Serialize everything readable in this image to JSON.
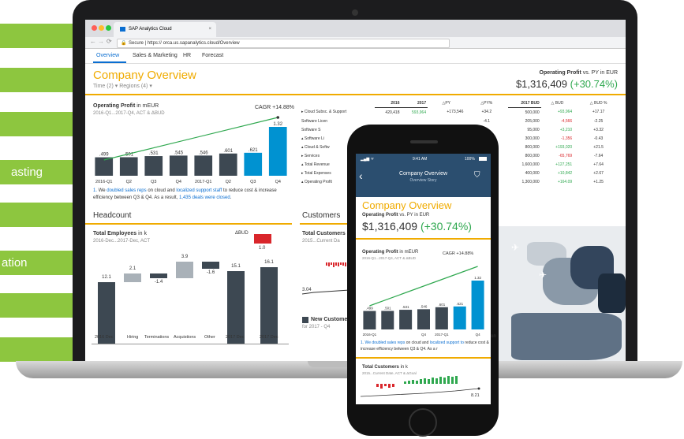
{
  "left_menu": {
    "items": [
      "",
      "",
      "",
      "asting",
      "",
      "ation",
      "",
      ""
    ]
  },
  "browser": {
    "tab_title": "SAP Analytics Cloud",
    "address": "Secure | https:// orca.us.sapanalytics.cloud/Overview"
  },
  "nav": {
    "tabs": [
      "Overview",
      "Sales & Marketing",
      "HR",
      "Forecast"
    ]
  },
  "page": {
    "title": "Company Overview",
    "filters": "Time (2) ▾  Regions (4) ▾",
    "kpi_label": "Operating Profit",
    "kpi_label_rest": "vs. PY in EUR",
    "kpi_value": "$1,316,409",
    "kpi_change": "(+30.74%)"
  },
  "op_chart": {
    "title": "Operating Profit",
    "title_rest": "in mEUR",
    "subtitle": "2016-Q1...2017-Q4, ACT & ΔBUD",
    "cagr": "CAGR +14.88%",
    "footnote_1": "1.",
    "footnote_a": "We",
    "footnote_link1": "doubled sales reps",
    "footnote_b": "on cloud and",
    "footnote_link2": "localized support staff",
    "footnote_c": "to reduce cost & increase",
    "footnote_d": "efficiency between Q3 & Q4. As a result,",
    "footnote_link3": "1,435 deals were closed",
    "footnote_e": "."
  },
  "chart_data": {
    "type": "bar",
    "categories": [
      "2016-Q1",
      "Q2",
      "Q3",
      "Q4",
      "2017-Q1",
      "Q2",
      "Q3",
      "Q4"
    ],
    "values": [
      0.499,
      0.501,
      0.531,
      0.545,
      0.546,
      0.601,
      0.621,
      1.32
    ],
    "value_labels": [
      ".499",
      ".501",
      ".531",
      ".545",
      ".546",
      ".601",
      ".621",
      "1.32"
    ],
    "colors": [
      "#3d4852",
      "#3d4852",
      "#3d4852",
      "#3d4852",
      "#3d4852",
      "#3d4852",
      "#0092d1",
      "#0092d1"
    ]
  },
  "headcount": {
    "section": "Headcount",
    "title": "Total Employees",
    "title_rest": "in k",
    "subtitle": "2016-Dec...2017-Dec, ACT",
    "dbud": "ΔBUD",
    "dbud_value": "1.0",
    "categories": [
      "2016 Dec",
      "Hiring",
      "Terminations",
      "Acquistions",
      "Other",
      "2017 Dec",
      "2017 Dec"
    ],
    "values": [
      "12.1",
      "2.1",
      "-1.4",
      "3.9",
      "-1.6",
      "15.1",
      "16.1"
    ]
  },
  "customers": {
    "section": "Customers",
    "title": "Total Customers",
    "subtitle": "2015...Current Da",
    "value": "3.04",
    "new_title": "New Custome",
    "new_sub": "for 2017 - Q4"
  },
  "pl_table": {
    "headers": [
      "2016",
      "2017",
      "△PY",
      "△PY%",
      "2017 BUD",
      "△ BUD",
      "△ BUD %"
    ],
    "rows": [
      {
        "label": "▸ Cloud Subsc. & Support",
        "v2016": "420,418",
        "v2017": "593,964",
        "dpy": "+173,546",
        "dpyp": "+34.2",
        "bud": "500,000",
        "dbud": "+93,964",
        "dbudp": "+17.17"
      },
      {
        "label": "Software Licen",
        "v2016": "",
        "v2017": "",
        "dpy": "",
        "dpyp": "-4.1",
        "bud": "205,000",
        "dbud": "-4,566",
        "dbudp": "-2.25"
      },
      {
        "label": "Software S",
        "v2016": "",
        "v2017": "",
        "dpy": "",
        "dpyp": "",
        "bud": "95,000",
        "dbud": "+3,210",
        "dbudp": "+3.32"
      },
      {
        "label": "▴ Software Li",
        "v2016": "",
        "v2017": "",
        "dpy": "",
        "dpyp": "",
        "bud": "300,000",
        "dbud": "-1,356",
        "dbudp": "-0.43"
      },
      {
        "label": "▴ Cloud & Softw",
        "v2016": "",
        "v2017": "",
        "dpy": "",
        "dpyp": "9.8",
        "bud": "800,000",
        "dbud": "+193,020",
        "dbudp": "+21.5"
      },
      {
        "label": "▸ Services",
        "v2016": "",
        "v2017": "",
        "dpy": "",
        "dpyp": "",
        "bud": "800,000",
        "dbud": "-65,769",
        "dbudp": "-7.64"
      },
      {
        "label": "▴ Total Revenue",
        "v2016": "",
        "v2017": "",
        "dpy": "",
        "dpyp": "",
        "bud": "1,600,000",
        "dbud": "+127,251",
        "dbudp": "+7.64"
      },
      {
        "label": "▸ Total Expenses",
        "v2016": "",
        "v2017": "",
        "dpy": "",
        "dpyp": "",
        "bud": "400,000",
        "dbud": "+10,842",
        "dbudp": "+2.67"
      },
      {
        "label": "▴ Operating Profit",
        "v2016": "",
        "v2017": "",
        "dpy": "",
        "dpyp": "",
        "bud": "1,300,000",
        "dbud": "+164.09",
        "dbudp": "+1.25"
      }
    ]
  },
  "phone": {
    "status_time": "9:41 AM",
    "status_batt": "100%",
    "header_title": "Company Overview",
    "header_sub": "Overview Story",
    "title": "Company Overview",
    "kpi_label": "Operating Profit",
    "kpi_label_rest": "vs. PY in EUR",
    "kpi_value": "$1,316,409",
    "kpi_change": "(+30.74%)",
    "chart_title": "Operating Profit",
    "chart_title_rest": "in mEUR",
    "chart_sub": "2016-Q1...2017-Q4, ACT & ΔBUD",
    "cagr": "CAGR +14.88%",
    "bar_labels": [
      ".499",
      ".501",
      ".531",
      ".546",
      ".601",
      ".621",
      "1.32"
    ],
    "x_labels": [
      "2016-Q1",
      "Q4",
      "2017-Q1",
      "Q4"
    ],
    "foot_1": "1. We",
    "foot_link1": "doubled sales reps",
    "foot_b": "on cloud and",
    "foot_link2": "localized support to",
    "foot_c": "reduce cost & increase efficiency between Q3 & Q4. As a r",
    "cust_title": "Total Customers",
    "cust_title_rest": "in k",
    "cust_sub": "2015...Current Date, ACT & ΔGoal",
    "cust_value": "8.21",
    "peek_label": "on"
  }
}
